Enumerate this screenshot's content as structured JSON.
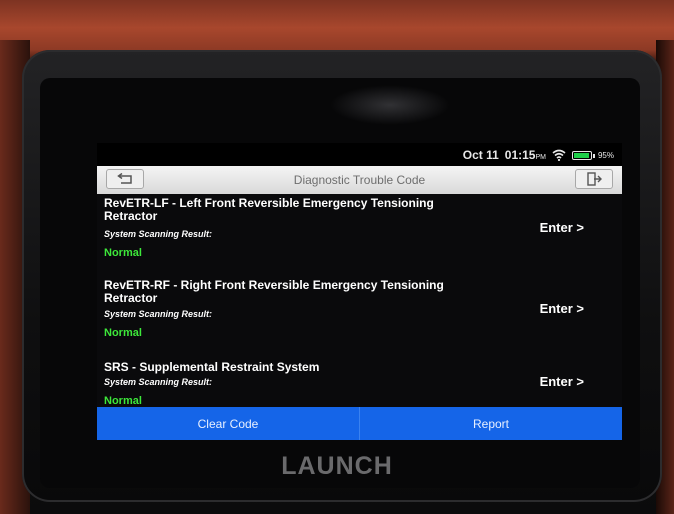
{
  "statusbar": {
    "date": "Oct 11",
    "time": "01:15",
    "ampm": "PM",
    "battery": "95%",
    "battery_level": 0.95
  },
  "header": {
    "title": "Diagnostic Trouble Code",
    "back_icon": "back-arrow-icon",
    "exit_icon": "exit-icon"
  },
  "systems": [
    {
      "name": "RevETR-LF - Left Front Reversible Emergency Tensioning Retractor",
      "result_label": "System Scanning Result:",
      "result": "Normal",
      "enter": "Enter >"
    },
    {
      "name": "RevETR-RF - Right Front Reversible Emergency Tensioning Retractor",
      "result_label": "System Scanning Result:",
      "result": "Normal",
      "enter": "Enter >"
    },
    {
      "name": "SRS - Supplemental Restraint System",
      "result_label": "System Scanning Result:",
      "result": "Normal",
      "enter": "Enter >"
    }
  ],
  "footer": {
    "clear_code": "Clear Code",
    "report": "Report"
  },
  "brand": "LAUNCH",
  "colors": {
    "accent": "#1565e8",
    "status_normal": "#3de83a"
  }
}
